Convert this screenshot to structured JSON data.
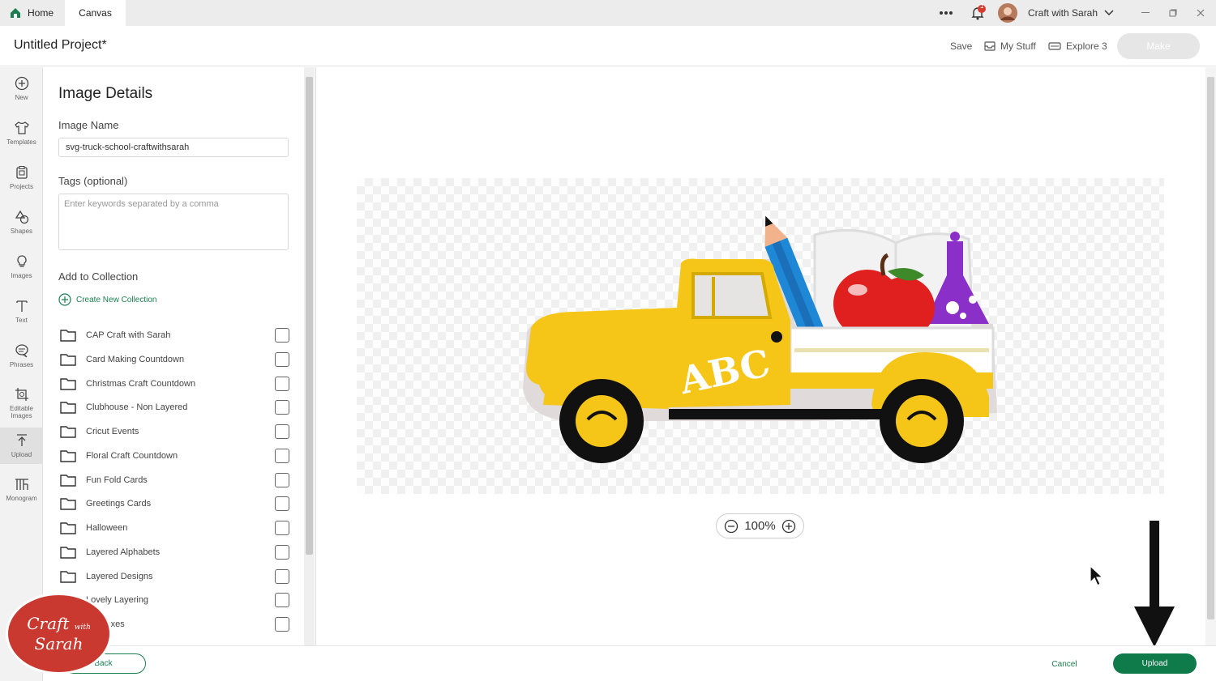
{
  "tabs": {
    "home": "Home",
    "canvas": "Canvas"
  },
  "topbar": {
    "notification_count": "1",
    "user_name": "Craft with Sarah"
  },
  "header": {
    "project_title": "Untitled Project*",
    "save": "Save",
    "my_stuff": "My Stuff",
    "machine": "Explore 3",
    "make": "Make"
  },
  "toolbar": [
    {
      "label": "New",
      "icon": "plus-circle-icon"
    },
    {
      "label": "Templates",
      "icon": "shirt-icon"
    },
    {
      "label": "Projects",
      "icon": "projects-icon"
    },
    {
      "label": "Shapes",
      "icon": "shapes-icon"
    },
    {
      "label": "Images",
      "icon": "lightbulb-icon"
    },
    {
      "label": "Text",
      "icon": "text-icon"
    },
    {
      "label": "Phrases",
      "icon": "speech-bubble-icon"
    },
    {
      "label": "Editable Images",
      "icon": "editable-images-icon"
    },
    {
      "label": "Upload",
      "icon": "upload-icon"
    },
    {
      "label": "Monogram",
      "icon": "monogram-icon"
    }
  ],
  "panel": {
    "title": "Image Details",
    "name_label": "Image Name",
    "name_value": "svg-truck-school-craftwithsarah",
    "tags_label": "Tags (optional)",
    "tags_placeholder": "Enter keywords separated by a comma",
    "collection_label": "Add to Collection",
    "create_collection": "Create New Collection",
    "collections": [
      "CAP Craft with Sarah",
      "Card Making Countdown",
      "Christmas Craft Countdown",
      "Clubhouse - Non Layered",
      "Cricut Events",
      "Floral Craft Countdown",
      "Fun Fold Cards",
      "Greetings Cards",
      "Halloween",
      "Layered Alphabets",
      "Layered Designs",
      "Lovely Layering",
      "ow Boxes"
    ]
  },
  "canvas": {
    "zoom": "100%",
    "truck_text": "ABC"
  },
  "footer": {
    "back": "Back",
    "cancel": "Cancel",
    "upload": "Upload"
  },
  "watermark": {
    "line1": "Craft",
    "line2": "with",
    "line3": "Sarah"
  },
  "colors": {
    "brand_green": "#0f7a4a",
    "truck_yellow": "#f5c518",
    "apple_red": "#e0201f",
    "pencil_blue": "#1e88d6",
    "flask_purple": "#8b2fc9"
  }
}
